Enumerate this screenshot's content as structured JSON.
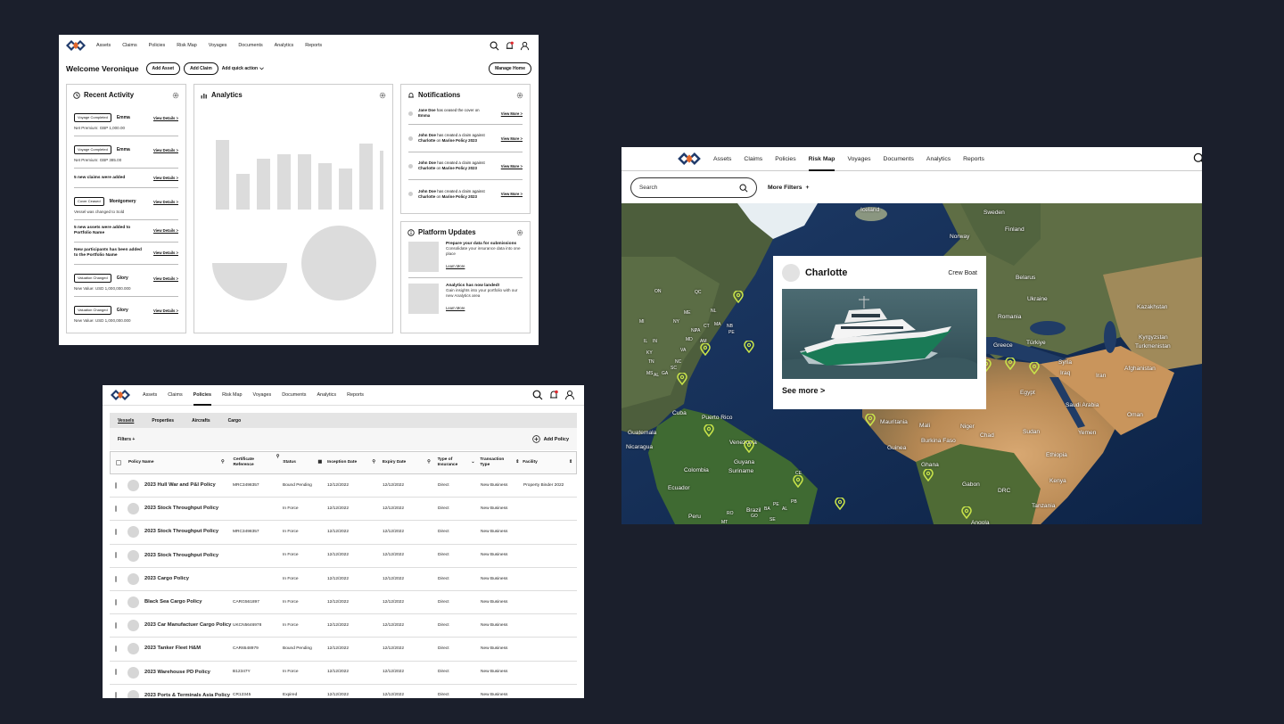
{
  "nav": {
    "items": [
      "Assets",
      "Claims",
      "Policies",
      "Risk Map",
      "Voyages",
      "Documents",
      "Analytics",
      "Reports"
    ]
  },
  "dashboard": {
    "welcome": "Welcome Veronique",
    "add_asset": "Add Asset",
    "add_claim": "Add Claim",
    "quick_action": "Add quick action",
    "manage_home": "Manage Home",
    "recent_activity": {
      "title": "Recent Activity",
      "items": [
        {
          "tag": "Voyage Completed",
          "name": "Emma",
          "sub": "Net Premium: GBP 1,000.00",
          "link": "View Details >"
        },
        {
          "tag": "Voyage Completed",
          "name": "Emma",
          "sub": "Net Premium: GBP 385.00",
          "link": "View Details >"
        },
        {
          "text": "5 new claims were added",
          "link": "View Details >"
        },
        {
          "tag": "Cover Ceased",
          "name": "Montgomery",
          "sub": "Vessel was changed to Sold",
          "link": "View Details >"
        },
        {
          "text": "5 new assets were added to Portfolio Name",
          "link": "View Details >"
        },
        {
          "text": "New participants has been added to the Portfolio Name",
          "link": "View Details >"
        },
        {
          "tag": "Valuation Changed",
          "name": "Glory",
          "sub": "New Value: USD 1,000,000.000",
          "link": "View Details >"
        },
        {
          "tag": "Valuation Changed",
          "name": "Glory",
          "sub": "New Value: USD 1,000,000.000",
          "link": "View Details >"
        }
      ]
    },
    "analytics": {
      "title": "Analytics",
      "bars": [
        0.78,
        0.4,
        0.57,
        0.62,
        0.62,
        0.52,
        0.46,
        0.74,
        0.66
      ]
    },
    "notifications": {
      "title": "Notifications",
      "items": [
        {
          "who": "Jane Doe",
          "mid": " has ceased the cover on ",
          "obj": "Emma",
          "tail": "",
          "tail_bold": "",
          "link": "View More >"
        },
        {
          "who": "John Doe",
          "mid": " has created a claim against ",
          "obj": "Charlotte",
          "tail": " on ",
          "tail_bold": "Marine Policy 2023",
          "link": "View More >"
        },
        {
          "who": "John Doe",
          "mid": " has created a claim against ",
          "obj": "Charlotte",
          "tail": " on ",
          "tail_bold": "Marine Policy 2023",
          "link": "View More >"
        },
        {
          "who": "John Doe",
          "mid": " has created a claim against ",
          "obj": "Charlotte",
          "tail": " on ",
          "tail_bold": "Marine Policy 2023",
          "link": "View More >"
        }
      ]
    },
    "platform_updates": {
      "title": "Platform Updates",
      "items": [
        {
          "title": "Prepare your data for submissions",
          "text": "Consolidate your insurance data into one place",
          "link": "Learn More"
        },
        {
          "title": "Analytics has now landed!",
          "text": "Gain insights into your portfolio with our new Analytics area",
          "link": "Learn More"
        }
      ]
    }
  },
  "policies": {
    "subtabs": [
      "Vessels",
      "Properties",
      "Aircrafts",
      "Cargo"
    ],
    "filters": "Filters",
    "add_policy": "Add Policy",
    "columns": [
      "Policy Name",
      "Certificate Reference",
      "Status",
      "Inception Date",
      "Expiry Date",
      "Type of Insurance",
      "Transaction Type",
      "Facility"
    ],
    "rows": [
      {
        "name": "2023 Hull War and P&I Policy",
        "ref": "MRC3498357",
        "status": "Bound Pending",
        "inception": "12/12/2022",
        "expiry": "12/12/2022",
        "type": "Direct",
        "transaction": "New Business",
        "facility": "Property Binder 2022"
      },
      {
        "name": "2023 Stock Throughput Policy",
        "ref": "",
        "status": "In Force",
        "inception": "12/12/2022",
        "expiry": "12/12/2022",
        "type": "Direct",
        "transaction": "New Business",
        "facility": ""
      },
      {
        "name": "2023 Stock Throughput Policy",
        "ref": "MRC3498357",
        "status": "In Force",
        "inception": "12/12/2022",
        "expiry": "12/12/2022",
        "type": "Direct",
        "transaction": "New Business",
        "facility": ""
      },
      {
        "name": "2023 Stock Throughput Policy",
        "ref": "",
        "status": "In Force",
        "inception": "12/12/2022",
        "expiry": "12/12/2022",
        "type": "Direct",
        "transaction": "New Business",
        "facility": ""
      },
      {
        "name": "2023 Cargo Policy",
        "ref": "",
        "status": "In Force",
        "inception": "12/12/2022",
        "expiry": "12/12/2022",
        "type": "Direct",
        "transaction": "New Business",
        "facility": ""
      },
      {
        "name": "Black Sea Cargo Policy",
        "ref": "CARG561897",
        "status": "In Force",
        "inception": "12/12/2022",
        "expiry": "12/12/2022",
        "type": "Direct",
        "transaction": "New Business",
        "facility": ""
      },
      {
        "name": "2023 Car Manufactuer Cargo Policy",
        "ref": "UKCN5646978",
        "status": "In Force",
        "inception": "12/12/2022",
        "expiry": "12/12/2022",
        "type": "Direct",
        "transaction": "New Business",
        "facility": ""
      },
      {
        "name": "2023 Tanker Fleet H&M",
        "ref": "CAR6548979",
        "status": "Bound Pending",
        "inception": "12/12/2022",
        "expiry": "12/12/2022",
        "type": "Direct",
        "transaction": "New Business",
        "facility": ""
      },
      {
        "name": "2023 Warehouse PD Policy",
        "ref": "B12347Y",
        "status": "In Force",
        "inception": "12/12/2022",
        "expiry": "12/12/2022",
        "type": "Direct",
        "transaction": "New Business",
        "facility": ""
      },
      {
        "name": "2023 Ports & Terminals Asia Policy",
        "ref": "CR12345",
        "status": "Expired",
        "inception": "12/12/2022",
        "expiry": "12/12/2022",
        "type": "Direct",
        "transaction": "New Business",
        "facility": ""
      }
    ]
  },
  "riskmap": {
    "active_tab": "Risk Map",
    "search_placeholder": "Search",
    "more_filters": "More Filters",
    "card": {
      "title": "Charlotte",
      "type": "Crew Boat",
      "more": "See more >"
    },
    "labels": [
      "Iceland",
      "Sweden",
      "Norway",
      "Finland",
      "Belarus",
      "Ukraine",
      "Kazakhstan",
      "Romania",
      "Kyrgyzstan",
      "Greece",
      "Türkiye",
      "Turkmenistan",
      "Syria",
      "Afghanistan",
      "Iraq",
      "Iran",
      "Egypt",
      "Saudi Arabia",
      "Oman",
      "Yemen",
      "Sudan",
      "Ethiopia",
      "Kenya",
      "Tanzania",
      "DRC",
      "Gabon",
      "Angola",
      "Chad",
      "Niger",
      "Mali",
      "Mauritania",
      "Burkina Faso",
      "Guinea",
      "Ghana",
      "Cuba",
      "Puerto Rico",
      "Guatemala",
      "Nicaragua",
      "Colombia",
      "Venezuela",
      "Guyana",
      "Suriname",
      "Ecuador",
      "Peru",
      "Brazil",
      "ON",
      "QC",
      "NL",
      "NB",
      "PE",
      "NY",
      "ME",
      "MI",
      "IL",
      "IN",
      "KY",
      "TN",
      "GA",
      "SC",
      "AL",
      "MS",
      "MD",
      "NJ",
      "VA",
      "NC",
      "CT",
      "AM",
      "PA",
      "MA",
      "CE",
      "PE",
      "PB",
      "AL",
      "SE",
      "RO",
      "BA",
      "GO",
      "MT"
    ],
    "pin_color": "#c9e44a"
  }
}
